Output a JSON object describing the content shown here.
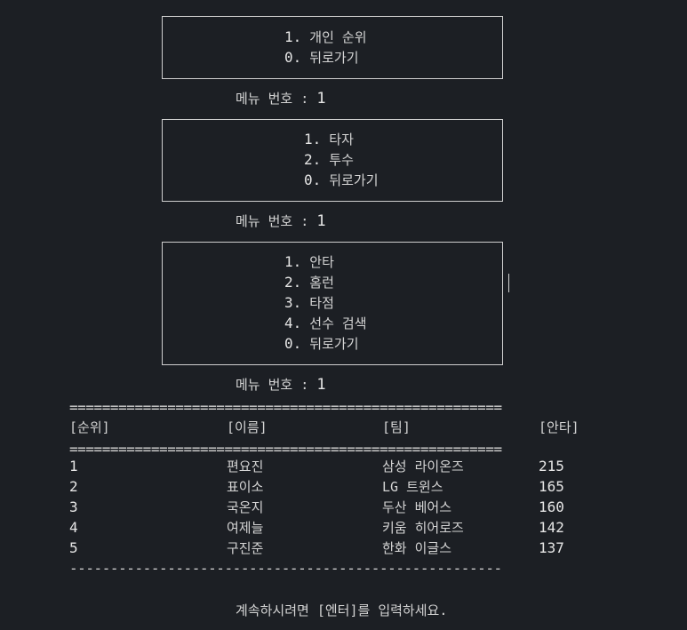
{
  "menu1": {
    "items": [
      {
        "num": "1.",
        "label": "개인 순위"
      },
      {
        "num": "0.",
        "label": "뒤로가기"
      }
    ]
  },
  "prompt1": {
    "label": "메뉴 번호 : ",
    "value": "1"
  },
  "menu2": {
    "items": [
      {
        "num": "1.",
        "label": "타자"
      },
      {
        "num": "2.",
        "label": "투수"
      },
      {
        "num": "0.",
        "label": "뒤로가기"
      }
    ]
  },
  "prompt2": {
    "label": "메뉴 번호 : ",
    "value": "1"
  },
  "menu3": {
    "items": [
      {
        "num": "1.",
        "label": "안타"
      },
      {
        "num": "2.",
        "label": "홈런"
      },
      {
        "num": "3.",
        "label": "타점"
      },
      {
        "num": "4.",
        "label": "선수 검색"
      },
      {
        "num": "0.",
        "label": "뒤로가기"
      }
    ]
  },
  "prompt3": {
    "label": "메뉴 번호 : ",
    "value": "1"
  },
  "rules": {
    "double": "=====================================================",
    "single": "-----------------------------------------------------"
  },
  "table": {
    "headers": [
      "[순위]",
      "[이름]",
      "[팀]",
      "[안타]"
    ],
    "rows": [
      {
        "rank": "1",
        "name": "편요진",
        "team": "삼성 라이온즈",
        "hits": "215"
      },
      {
        "rank": "2",
        "name": "표이소",
        "team": "LG 트윈스",
        "hits": "165"
      },
      {
        "rank": "3",
        "name": "국온지",
        "team": "두산 베어스",
        "hits": "160"
      },
      {
        "rank": "4",
        "name": "여제늘",
        "team": "키움 히어로즈",
        "hits": "142"
      },
      {
        "rank": "5",
        "name": "구진준",
        "team": "한화 이글스",
        "hits": "137"
      }
    ]
  },
  "footer": {
    "text": "계속하시려면 [엔터]를 입력하세요."
  }
}
